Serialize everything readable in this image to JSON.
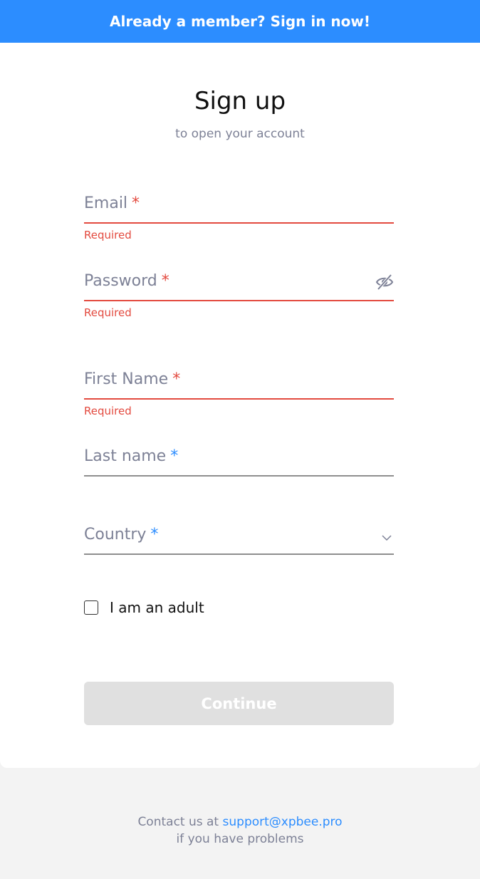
{
  "banner": {
    "text": "Already a member? Sign in now!"
  },
  "header": {
    "title": "Sign up",
    "subtitle": "to open your account"
  },
  "form": {
    "email": {
      "label": "Email",
      "required_mark": "*",
      "error": "Required"
    },
    "password": {
      "label": "Password",
      "required_mark": "*",
      "error": "Required",
      "toggle_icon": "eye-off-icon"
    },
    "first_name": {
      "label": "First Name",
      "required_mark": "*",
      "error": "Required"
    },
    "last_name": {
      "label": "Last name",
      "required_mark": "*"
    },
    "country": {
      "label": "Country",
      "required_mark": "*",
      "icon": "chevron-down-icon"
    },
    "adult_checkbox": {
      "label": "I am an adult",
      "checked": false
    },
    "continue_label": "Continue"
  },
  "footer": {
    "prefix": "Contact us at",
    "email": "support@xpbee.pro",
    "suffix": "if you have problems"
  },
  "colors": {
    "accent": "#2c8dff",
    "error": "#e34a3f",
    "muted_text": "#7d8196",
    "disabled_button": "#e0e0e0"
  }
}
